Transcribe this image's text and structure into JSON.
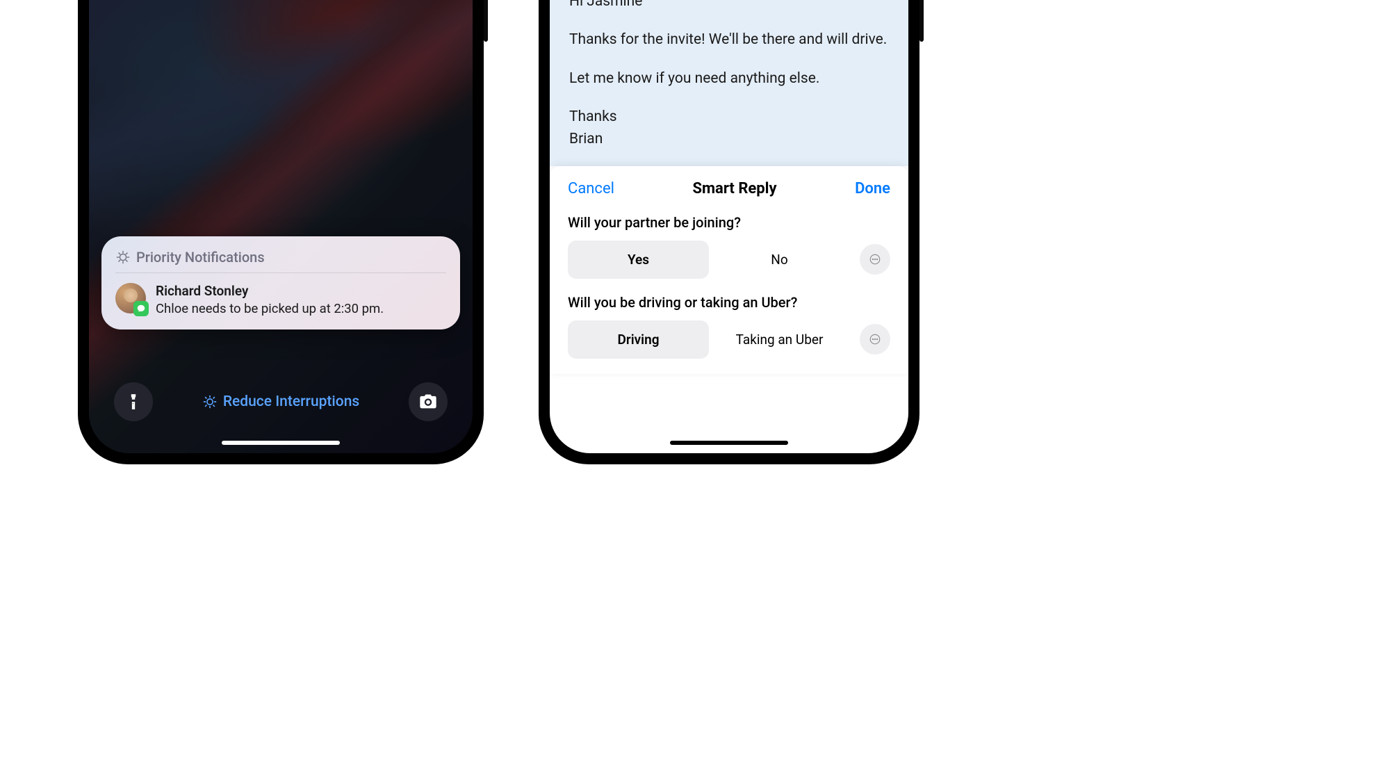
{
  "left_phone": {
    "priority_label": "Priority Notifications",
    "notification": {
      "sender": "Richard Stonley",
      "message": "Chloe needs to be picked up at 2:30 pm."
    },
    "focus_label": "Reduce Interruptions"
  },
  "right_phone": {
    "email": {
      "greeting": "Hi Jasmine",
      "paragraph1": "Thanks for the invite! We'll be there and will drive.",
      "paragraph2": "Let me know if you need anything else.",
      "signoff": "Thanks",
      "sender_name": "Brian"
    },
    "smart_reply": {
      "cancel": "Cancel",
      "title": "Smart Reply",
      "done": "Done",
      "questions": [
        {
          "text": "Will your partner be joining?",
          "options": [
            "Yes",
            "No"
          ],
          "selected": 0
        },
        {
          "text": "Will you be driving or taking an Uber?",
          "options": [
            "Driving",
            "Taking an Uber"
          ],
          "selected": 0
        }
      ]
    }
  }
}
